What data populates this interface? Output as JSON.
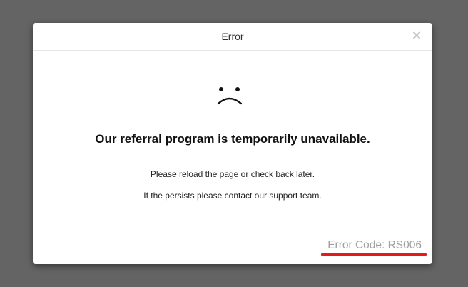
{
  "modal": {
    "title": "Error",
    "close_label": "×"
  },
  "body": {
    "icon": "sad-face-icon",
    "heading": "Our referral program is temporarily unavailable.",
    "message_line1": "Please reload the page or check back later.",
    "message_line2": "If the persists please contact our support team.",
    "error_code": "Error Code: RS006"
  },
  "colors": {
    "backdrop": "#646464",
    "underline": "#e31b1b",
    "error_code_text": "#a0a0a0"
  }
}
